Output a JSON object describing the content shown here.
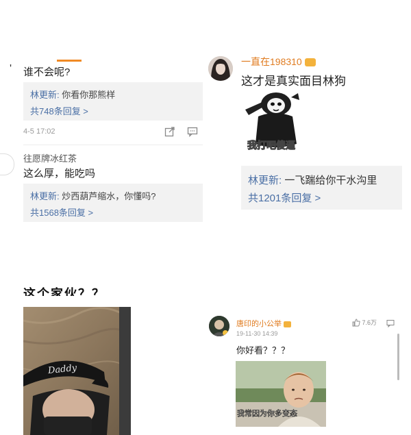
{
  "top_left": {
    "comment1": {
      "text": "谁不会呢?"
    },
    "reply1": {
      "author": "林更新:",
      "text": " 你看你那熊样",
      "count": "共748条回复 >"
    },
    "meta": {
      "date": "4-5 17:02"
    },
    "comment2": {
      "author": "往愿牌冰红茶",
      "text": "这么厚，能吃吗"
    },
    "reply2": {
      "author": "林更新:",
      "text": " 炒西葫芦缩水，你懂吗?",
      "count": "共1568条回复 >"
    }
  },
  "top_right": {
    "username": "一直在198310",
    "text": "这才是真实面目林狗",
    "sticker_caption": "我打吧傻逼",
    "reply": {
      "author": "林更新:",
      "text": " 一飞踹给你干水沟里",
      "count": "共1201条回复 >"
    }
  },
  "bottom_left": {
    "caption": "这个家伙？？",
    "cap_text": "Daddy"
  },
  "bottom_right": {
    "username": "唐印的小公举",
    "likes": "7.6万",
    "date": "19-11-30 14:39",
    "text": "你好看？？？",
    "meme_caption": "我常因为你多变态"
  },
  "colors": {
    "link": "#4a6fa5",
    "name_orange": "#e07b1f",
    "reply_bg": "#f2f2f2"
  }
}
